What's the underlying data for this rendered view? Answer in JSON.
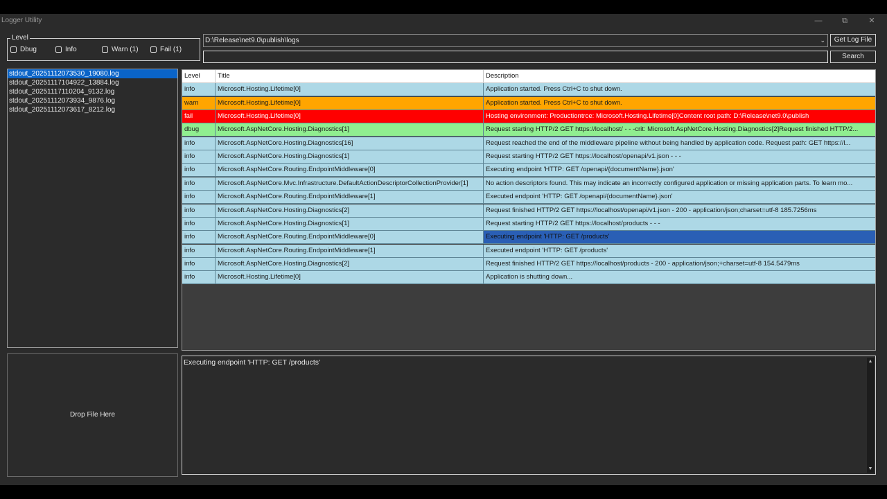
{
  "window": {
    "title": "Logger Utility"
  },
  "level": {
    "legend": "Level",
    "filters": [
      {
        "label": "Dbug",
        "checked": false
      },
      {
        "label": "Info",
        "checked": false
      },
      {
        "label": "Warn (1)",
        "checked": false
      },
      {
        "label": "Fail (1)",
        "checked": false
      }
    ]
  },
  "path": {
    "value": "D:\\Release\\net9.0\\publish\\logs"
  },
  "search": {
    "value": "",
    "placeholder": ""
  },
  "buttons": {
    "get_log_file": "Get Log File",
    "search": "Search"
  },
  "files": [
    {
      "name": "stdout_20251112073530_19080.log",
      "selected": true
    },
    {
      "name": "stdout_20251117104922_13884.log",
      "selected": false
    },
    {
      "name": "stdout_20251117110204_9132.log",
      "selected": false
    },
    {
      "name": "stdout_20251112073934_9876.log",
      "selected": false
    },
    {
      "name": "stdout_20251112073617_8212.log",
      "selected": false
    }
  ],
  "grid": {
    "columns": [
      "Level",
      "Title",
      "Description"
    ],
    "rows": [
      {
        "level": "info",
        "title": "Microsoft.Hosting.Lifetime[0]",
        "description": "Application started. Press Ctrl+C to shut down."
      },
      {
        "level": "warn",
        "title": "Microsoft.Hosting.Lifetime[0]",
        "description": "Application started. Press Ctrl+C to shut down."
      },
      {
        "level": "fail",
        "title": "Microsoft.Hosting.Lifetime[0]",
        "description": "Hosting environment: Productiontrce: Microsoft.Hosting.Lifetime[0]Content root path: D:\\Release\\net9.0\\publish"
      },
      {
        "level": "dbug",
        "title": "Microsoft.AspNetCore.Hosting.Diagnostics[1]",
        "description": "Request starting HTTP/2 GET https://localhost/ - - -crit: Microsoft.AspNetCore.Hosting.Diagnostics[2]Request finished HTTP/2..."
      },
      {
        "level": "info",
        "title": "Microsoft.AspNetCore.Hosting.Diagnostics[16]",
        "description": "Request reached the end of the middleware pipeline without being handled by application code. Request path: GET https://l..."
      },
      {
        "level": "info",
        "title": "Microsoft.AspNetCore.Hosting.Diagnostics[1]",
        "description": "Request starting HTTP/2 GET https://localhost/openapi/v1.json - - -"
      },
      {
        "level": "info",
        "title": "Microsoft.AspNetCore.Routing.EndpointMiddleware[0]",
        "description": "Executing endpoint 'HTTP: GET /openapi/{documentName}.json'"
      },
      {
        "level": "info",
        "title": "Microsoft.AspNetCore.Mvc.Infrastructure.DefaultActionDescriptorCollectionProvider[1]",
        "description": "No action descriptors found. This may indicate an incorrectly configured application or missing application parts. To learn mo..."
      },
      {
        "level": "info",
        "title": "Microsoft.AspNetCore.Routing.EndpointMiddleware[1]",
        "description": "Executed endpoint 'HTTP: GET /openapi/{documentName}.json'"
      },
      {
        "level": "info",
        "title": "Microsoft.AspNetCore.Hosting.Diagnostics[2]",
        "description": "Request finished HTTP/2 GET https://localhost/openapi/v1.json - 200 - application/json;charset=utf-8 185.7256ms"
      },
      {
        "level": "info",
        "title": "Microsoft.AspNetCore.Hosting.Diagnostics[1]",
        "description": "Request starting HTTP/2 GET https://localhost/products - - -"
      },
      {
        "level": "info",
        "title": "Microsoft.AspNetCore.Routing.EndpointMiddleware[0]",
        "description": "Executing endpoint 'HTTP: GET /products'",
        "selected": true
      },
      {
        "level": "info",
        "title": "Microsoft.AspNetCore.Routing.EndpointMiddleware[1]",
        "description": "Executed endpoint 'HTTP: GET /products'"
      },
      {
        "level": "info",
        "title": "Microsoft.AspNetCore.Hosting.Diagnostics[2]",
        "description": "Request finished HTTP/2 GET https://localhost/products - 200 - application/json;+charset=utf-8 154.5479ms"
      },
      {
        "level": "info",
        "title": "Microsoft.Hosting.Lifetime[0]",
        "description": "Application is shutting down..."
      }
    ]
  },
  "level_colors": {
    "info": "#add8e6",
    "warn": "#ffa500",
    "fail": "#ff0000",
    "dbug": "#90ee90"
  },
  "drop_zone": {
    "label": "Drop File Here"
  },
  "detail": {
    "text": "Executing endpoint 'HTTP: GET /products'"
  }
}
